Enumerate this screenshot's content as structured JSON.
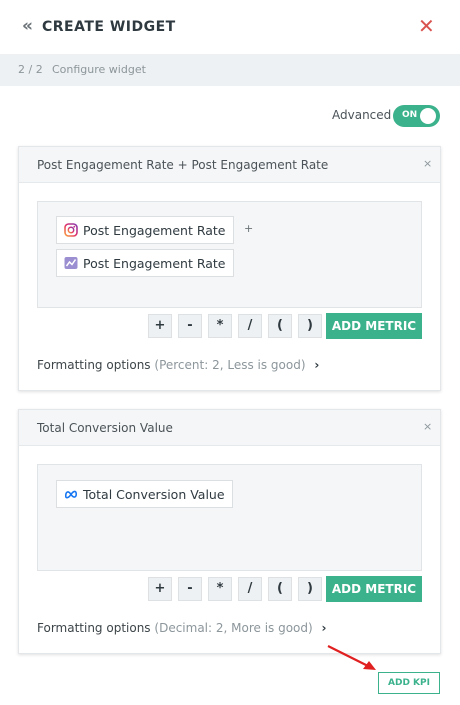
{
  "header": {
    "title": "CREATE WIDGET",
    "back_icon": "double-chevron-left-icon",
    "close_icon": "close-x-icon"
  },
  "stepbar": {
    "step": "2 / 2",
    "title": "Configure widget"
  },
  "advanced": {
    "label": "Advanced",
    "toggle_text": "ON",
    "enabled": true
  },
  "colors": {
    "accent": "#3bb28c",
    "close": "#d9534f",
    "arrow": "#e02020"
  },
  "kpis": [
    {
      "name": "Post Engagement Rate + Post Engagement Rate",
      "remove": "×",
      "metrics": [
        {
          "label": "Post Engagement Rate",
          "icon": "instagram-icon"
        },
        {
          "label": "Post Engagement Rate",
          "icon": "analytics-chart-icon"
        }
      ],
      "operator": "+",
      "operators": [
        "+",
        "-",
        "*",
        "/",
        "(",
        ")"
      ],
      "add_metric": "ADD METRIC",
      "formatting_label": "Formatting options",
      "formatting_detail": "(Percent: 2, Less is good)"
    },
    {
      "name": "Total Conversion Value",
      "remove": "×",
      "metrics": [
        {
          "label": "Total Conversion Value",
          "icon": "meta-icon"
        }
      ],
      "operators": [
        "+",
        "-",
        "*",
        "/",
        "(",
        ")"
      ],
      "add_metric": "ADD METRIC",
      "formatting_label": "Formatting options",
      "formatting_detail": "(Decimal: 2, More is good)"
    }
  ],
  "footer": {
    "add_kpi": "ADD KPI"
  }
}
